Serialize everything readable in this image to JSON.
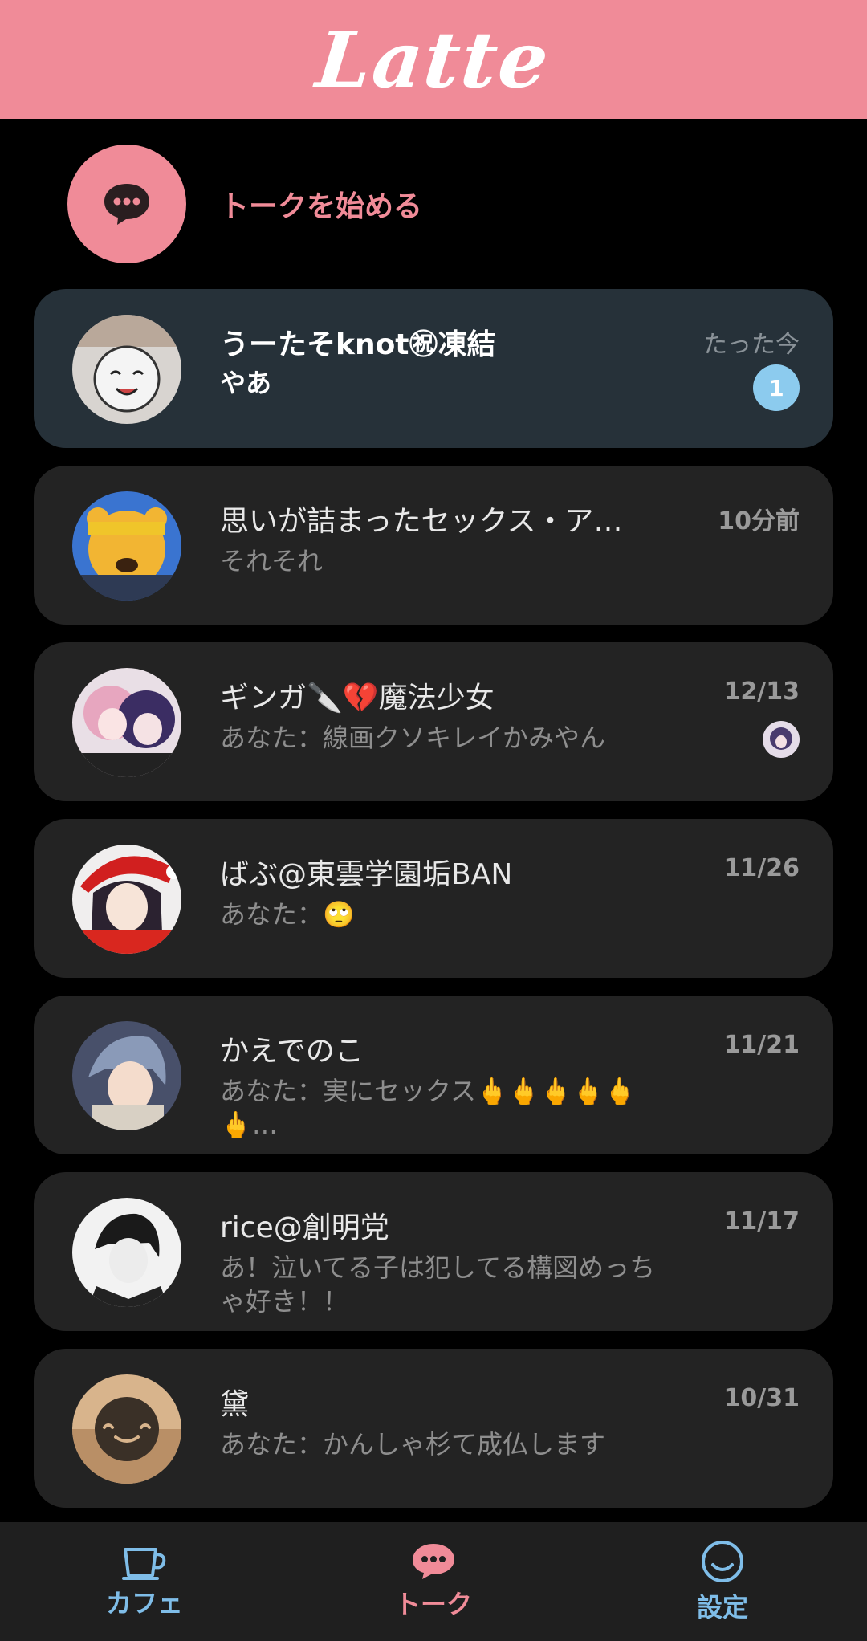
{
  "header": {
    "logo": "Latte",
    "bg_color": "#f08b98"
  },
  "start_talk": {
    "label": "トークを始める",
    "icon": "chat-bubble-icon"
  },
  "conversations": [
    {
      "name": "うーたそknot㊗凍結",
      "message": "やあ",
      "time": "たった今",
      "unread_count": "1",
      "unread": true
    },
    {
      "name": "思いが詰まったセックス・ア…",
      "message": "それそれ",
      "time": "10分前"
    },
    {
      "name": "ギンガ🔪💔魔法少女",
      "message": "あなた：線画クソキレイかみやん",
      "time": "12/13"
    },
    {
      "name": "ばぶ@東雲学園垢BAN",
      "message": "あなた：🙄",
      "time": "11/26"
    },
    {
      "name": "かえでのこ",
      "message": "あなた：実にセックス🖕🖕🖕🖕🖕🖕…",
      "time": "11/21"
    },
    {
      "name": "rice@創明党",
      "message": "あ！泣いてる子は犯してる構図めっちゃ好き！！",
      "time": "11/17"
    },
    {
      "name": "黛",
      "message": "あなた：かんしゃ杉て成仏します",
      "time": "10/31"
    }
  ],
  "nav": {
    "cafe": "カフェ",
    "talk": "トーク",
    "settings": "設定"
  },
  "colors": {
    "accent": "#f08b98",
    "unread_badge": "#8ccbee",
    "nav_blue": "#7fbde8"
  }
}
